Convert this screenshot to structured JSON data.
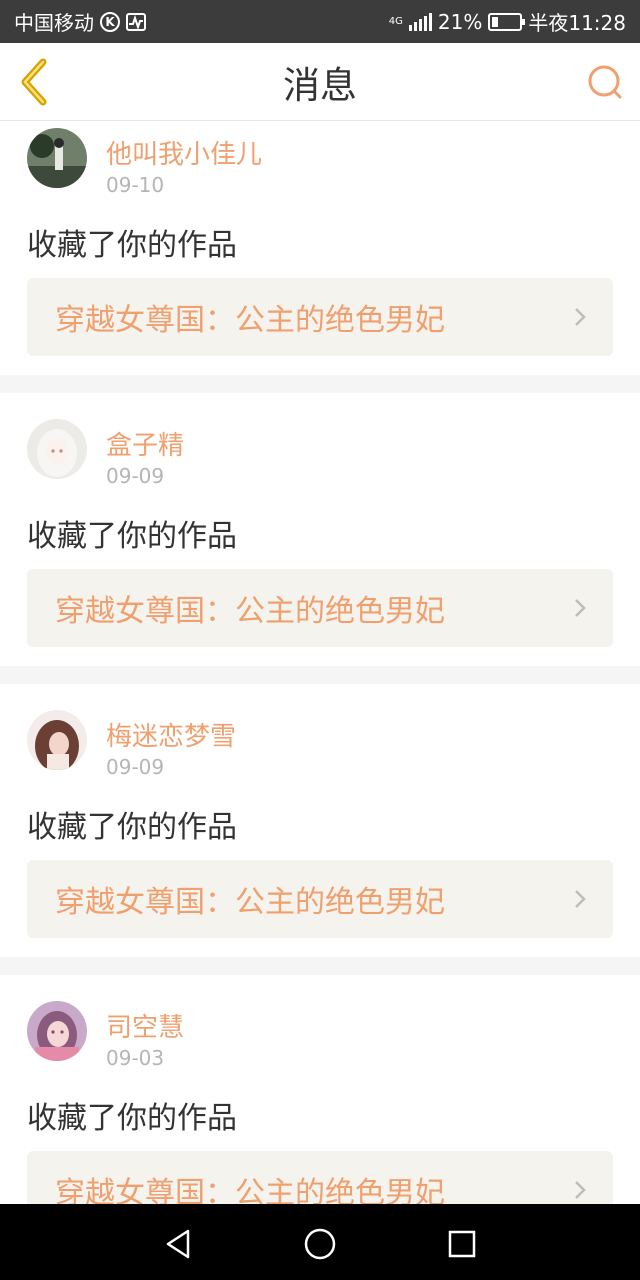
{
  "status_bar": {
    "carrier": "中国移动",
    "k_badge": "K",
    "network": "4G",
    "battery_percent": "21%",
    "battery_level": 0.21,
    "time": "半夜11:28"
  },
  "header": {
    "title": "消息",
    "back_icon": "chevron-left-icon",
    "search_icon": "search-icon"
  },
  "colors": {
    "accent": "#f0a06e",
    "text": "#333333",
    "muted": "#b5b5b5",
    "link_bg": "#f4f3ee"
  },
  "messages": [
    {
      "username": "他叫我小佳儿",
      "date": "09-10",
      "action": "收藏了你的作品",
      "work_title": "穿越女尊国：公主的绝色男妃"
    },
    {
      "username": "盒子精",
      "date": "09-09",
      "action": "收藏了你的作品",
      "work_title": "穿越女尊国：公主的绝色男妃"
    },
    {
      "username": "梅迷恋梦雪",
      "date": "09-09",
      "action": "收藏了你的作品",
      "work_title": "穿越女尊国：公主的绝色男妃"
    },
    {
      "username": "司空慧",
      "date": "09-03",
      "action": "收藏了你的作品",
      "work_title": "穿越女尊国：公主的绝色男妃"
    }
  ],
  "system_nav": {
    "back": "back-triangle-icon",
    "home": "home-circle-icon",
    "recents": "recents-square-icon"
  }
}
